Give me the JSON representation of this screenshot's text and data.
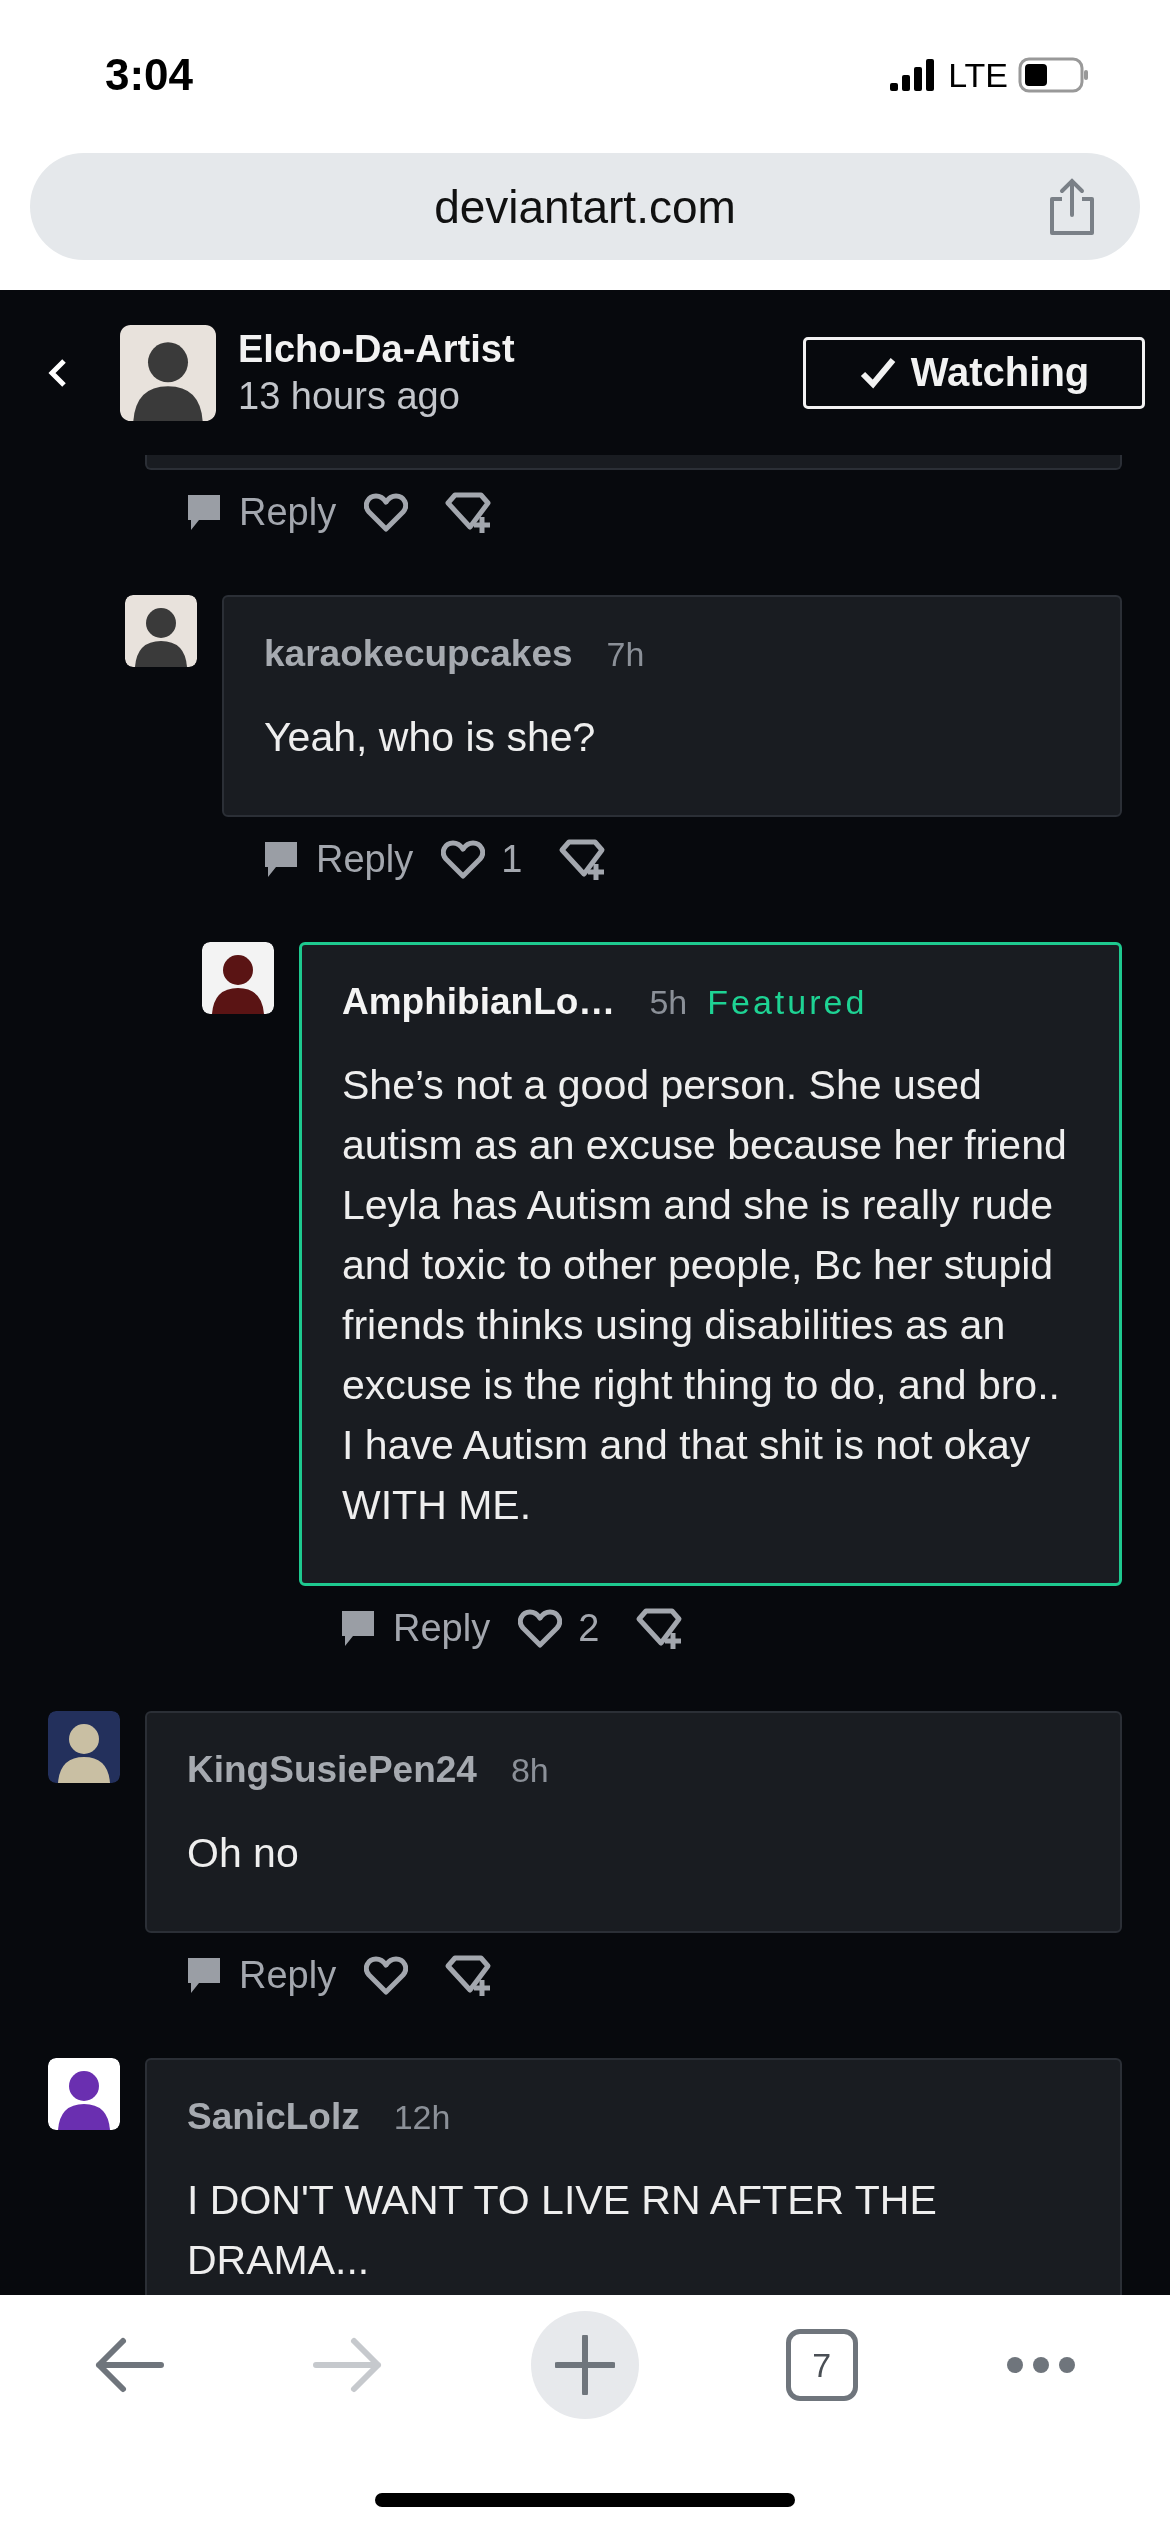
{
  "status_bar": {
    "time": "3:04",
    "network": "LTE"
  },
  "address_bar": {
    "url": "deviantart.com"
  },
  "header": {
    "author": "Elcho-Da-Artist",
    "posted": "13 hours ago",
    "watch_button": {
      "label": "Watching",
      "checked": true
    }
  },
  "comments": [
    {
      "partial": true,
      "featured": false,
      "reply_label": "Reply",
      "children": [
        {
          "user": "karaokecupcakes",
          "time": "7h",
          "featured": false,
          "text": "Yeah, who is she?",
          "reply_label": "Reply",
          "likes": "1",
          "children": [
            {
              "user": "AmphibianLo…",
              "time": "5h",
              "featured": true,
              "badge": "Featured",
              "text": "She’s not a good person. She used autism as an excuse because her friend Leyla has Autism and she is really rude and toxic to other people, Bc her stupid friends thinks using disabilities as an excuse is the right thing to do, and bro.. I have Autism and that shit is not okay WITH ME.",
              "reply_label": "Reply",
              "likes": "2"
            }
          ]
        }
      ]
    },
    {
      "user": "KingSusiePen24",
      "time": "8h",
      "featured": false,
      "text": "Oh no",
      "reply_label": "Reply"
    },
    {
      "user": "SanicLolz",
      "time": "12h",
      "featured": false,
      "text": "I DON'T WANT TO LIVE RN AFTER THE DRAMA..."
    }
  ],
  "toolbar": {
    "tab_count": "7"
  }
}
